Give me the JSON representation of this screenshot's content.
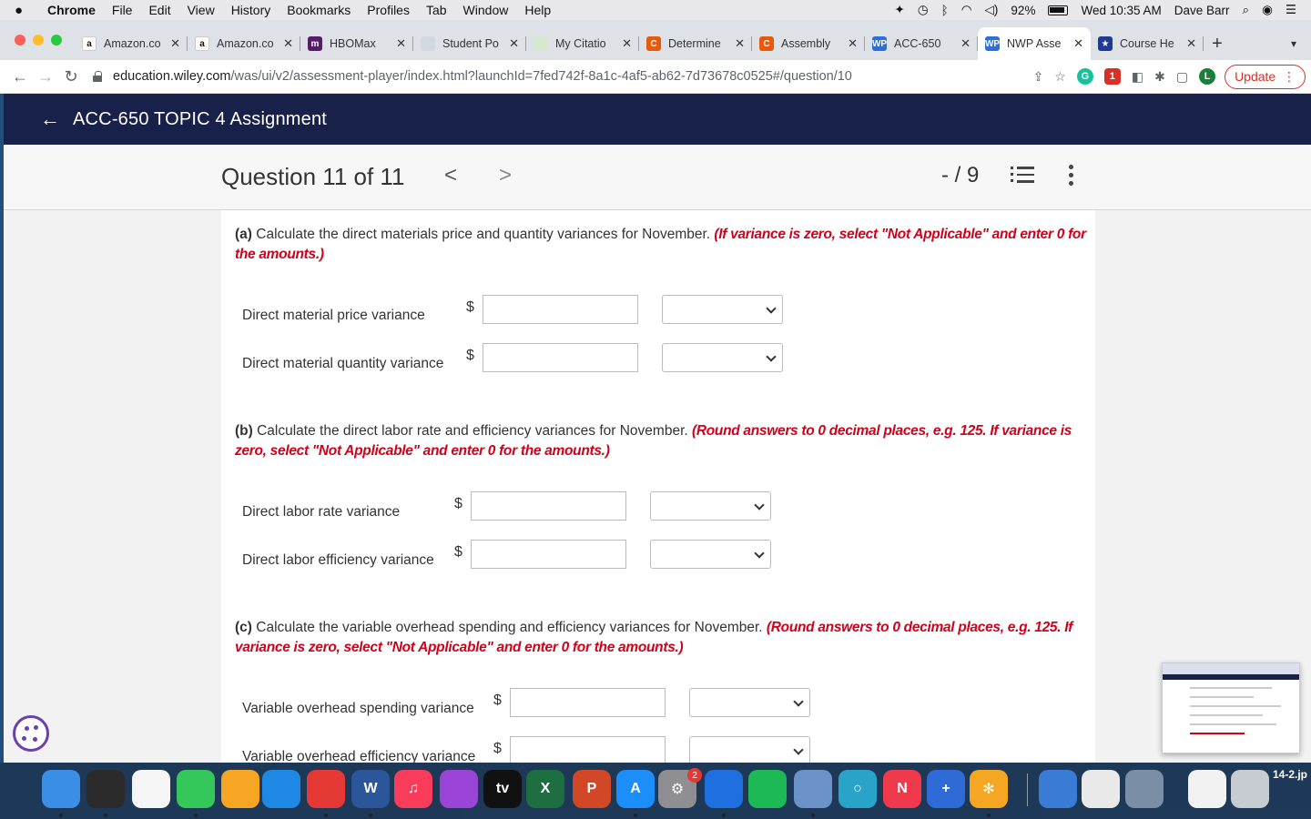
{
  "menubar": {
    "app": "Chrome",
    "items": [
      "File",
      "Edit",
      "View",
      "History",
      "Bookmarks",
      "Profiles",
      "Tab",
      "Window",
      "Help"
    ],
    "battery": "92%",
    "clock": "Wed 10:35 AM",
    "user": "Dave Barr"
  },
  "tabs": [
    {
      "label": "Amazon.co",
      "icon": "amazon-icon",
      "fav": "a",
      "color": "#ffffff",
      "fg": "#111111"
    },
    {
      "label": "Amazon.co",
      "icon": "amazon-icon",
      "fav": "a",
      "color": "#ffffff",
      "fg": "#111111"
    },
    {
      "label": "HBOMax",
      "icon": "hbomax-icon",
      "fav": "m",
      "color": "#5b1b6b",
      "fg": "#ffffff"
    },
    {
      "label": "Student Po",
      "icon": "document-icon",
      "fav": "",
      "color": "#cfd8e3",
      "fg": "#333333"
    },
    {
      "label": "My Citatio",
      "icon": "citation-icon",
      "fav": "",
      "color": "#d9e7d0",
      "fg": "#333333"
    },
    {
      "label": "Determine",
      "icon": "chegg-icon",
      "fav": "C",
      "color": "#e8590c",
      "fg": "#ffffff"
    },
    {
      "label": "Assembly",
      "icon": "chegg-icon",
      "fav": "C",
      "color": "#e8590c",
      "fg": "#ffffff"
    },
    {
      "label": "ACC-650",
      "icon": "wileyplus-icon",
      "fav": "WP",
      "color": "#2a6fdb",
      "fg": "#ffffff"
    },
    {
      "label": "NWP Asse",
      "icon": "wileyplus-icon",
      "fav": "WP",
      "color": "#2a6fdb",
      "fg": "#ffffff",
      "active": true
    },
    {
      "label": "Course He",
      "icon": "coursehero-icon",
      "fav": "★",
      "color": "#1f3a93",
      "fg": "#ffffff"
    }
  ],
  "address": {
    "domain": "education.wiley.com",
    "path": "/was/ui/v2/assessment-player/index.html?launchId=7fed742f-8a1c-4af5-ab62-7d73678c0525#/question/10",
    "update_label": "Update",
    "profile_initial": "L"
  },
  "app": {
    "title": "ACC-650 TOPIC 4 Assignment"
  },
  "question": {
    "title": "Question 11 of 11",
    "score": "- / 9"
  },
  "parts": [
    {
      "id": "a",
      "label": "(a)",
      "text": "Calculate the direct materials price and quantity variances for November.",
      "instruction": "(If variance is zero, select \"Not Applicable\" and enter 0 for the amounts.)",
      "rows": [
        {
          "label": "Direct material price variance",
          "currency": "$",
          "value": "",
          "select": ""
        },
        {
          "label": "Direct material quantity variance",
          "currency": "$",
          "value": "",
          "select": ""
        }
      ]
    },
    {
      "id": "b",
      "label": "(b)",
      "text": "Calculate the direct labor rate and efficiency variances for November.",
      "instruction": "(Round answers to 0 decimal places, e.g. 125. If variance is zero, select \"Not Applicable\" and enter 0 for the amounts.)",
      "rows": [
        {
          "label": "Direct labor rate variance",
          "currency": "$",
          "value": "",
          "select": ""
        },
        {
          "label": "Direct labor efficiency variance",
          "currency": "$",
          "value": "",
          "select": ""
        }
      ]
    },
    {
      "id": "c",
      "label": "(c)",
      "text": "Calculate the variable overhead spending and efficiency variances for November.",
      "instruction": "(Round answers to 0 decimal places, e.g. 125. If variance is zero, select \"Not Applicable\" and enter 0 for the amounts.)",
      "rows": [
        {
          "label": "Variable overhead spending variance",
          "currency": "$",
          "value": "",
          "select": ""
        },
        {
          "label": "Variable overhead efficiency variance",
          "currency": "$",
          "value": "",
          "select": ""
        }
      ]
    }
  ],
  "dock": {
    "items": [
      {
        "icon": "finder-icon",
        "color": "#3a8ee6",
        "glyph": ""
      },
      {
        "icon": "activity-monitor-icon",
        "color": "#2b2b2b",
        "glyph": ""
      },
      {
        "icon": "reminders-icon",
        "color": "#f5f5f5",
        "glyph": ""
      },
      {
        "icon": "facetime-icon",
        "color": "#34c759",
        "glyph": ""
      },
      {
        "icon": "photos-icon",
        "color": "#f6a623",
        "glyph": ""
      },
      {
        "icon": "safari-icon",
        "color": "#1e88e5",
        "glyph": ""
      },
      {
        "icon": "chrome-icon",
        "color": "#e53935",
        "glyph": ""
      },
      {
        "icon": "word-icon",
        "color": "#2b579a",
        "glyph": "W"
      },
      {
        "icon": "music-icon",
        "color": "#fa3c5a",
        "glyph": "♫"
      },
      {
        "icon": "podcasts-icon",
        "color": "#9b45d8",
        "glyph": ""
      },
      {
        "icon": "apple-tv-icon",
        "color": "#111111",
        "glyph": "tv"
      },
      {
        "icon": "excel-icon",
        "color": "#1d6f42",
        "glyph": "X"
      },
      {
        "icon": "powerpoint-icon",
        "color": "#d24726",
        "glyph": "P"
      },
      {
        "icon": "app-store-icon",
        "color": "#1c8ef9",
        "glyph": "A"
      },
      {
        "icon": "system-preferences-icon",
        "color": "#8e8e93",
        "glyph": "⚙"
      },
      {
        "icon": "bluetooth-icon",
        "color": "#1e6fe0",
        "glyph": ""
      },
      {
        "icon": "spotify-icon",
        "color": "#1db954",
        "glyph": ""
      },
      {
        "icon": "preview-icon",
        "color": "#6b93c9",
        "glyph": ""
      },
      {
        "icon": "screenshot-icon",
        "color": "#2aa3c9",
        "glyph": "○"
      },
      {
        "icon": "news-icon",
        "color": "#f0394b",
        "glyph": "N"
      },
      {
        "icon": "keynote-icon",
        "color": "#2f6bd6",
        "glyph": "+"
      },
      {
        "icon": "sunflower-icon",
        "color": "#f5a623",
        "glyph": "✻"
      },
      {
        "icon": "network-radar-icon",
        "color": "#3a7bd5",
        "glyph": ""
      },
      {
        "icon": "textedit-icon",
        "color": "#e9e9e9",
        "glyph": ""
      },
      {
        "icon": "preview-stamp-icon",
        "color": "#7a8fa6",
        "glyph": ""
      },
      {
        "icon": "document-thumbnail-icon",
        "color": "#f2f2f2",
        "glyph": ""
      },
      {
        "icon": "trash-icon",
        "color": "#c7ccd3",
        "glyph": ""
      }
    ],
    "badge": "2",
    "file_label": "14-2.jp"
  }
}
